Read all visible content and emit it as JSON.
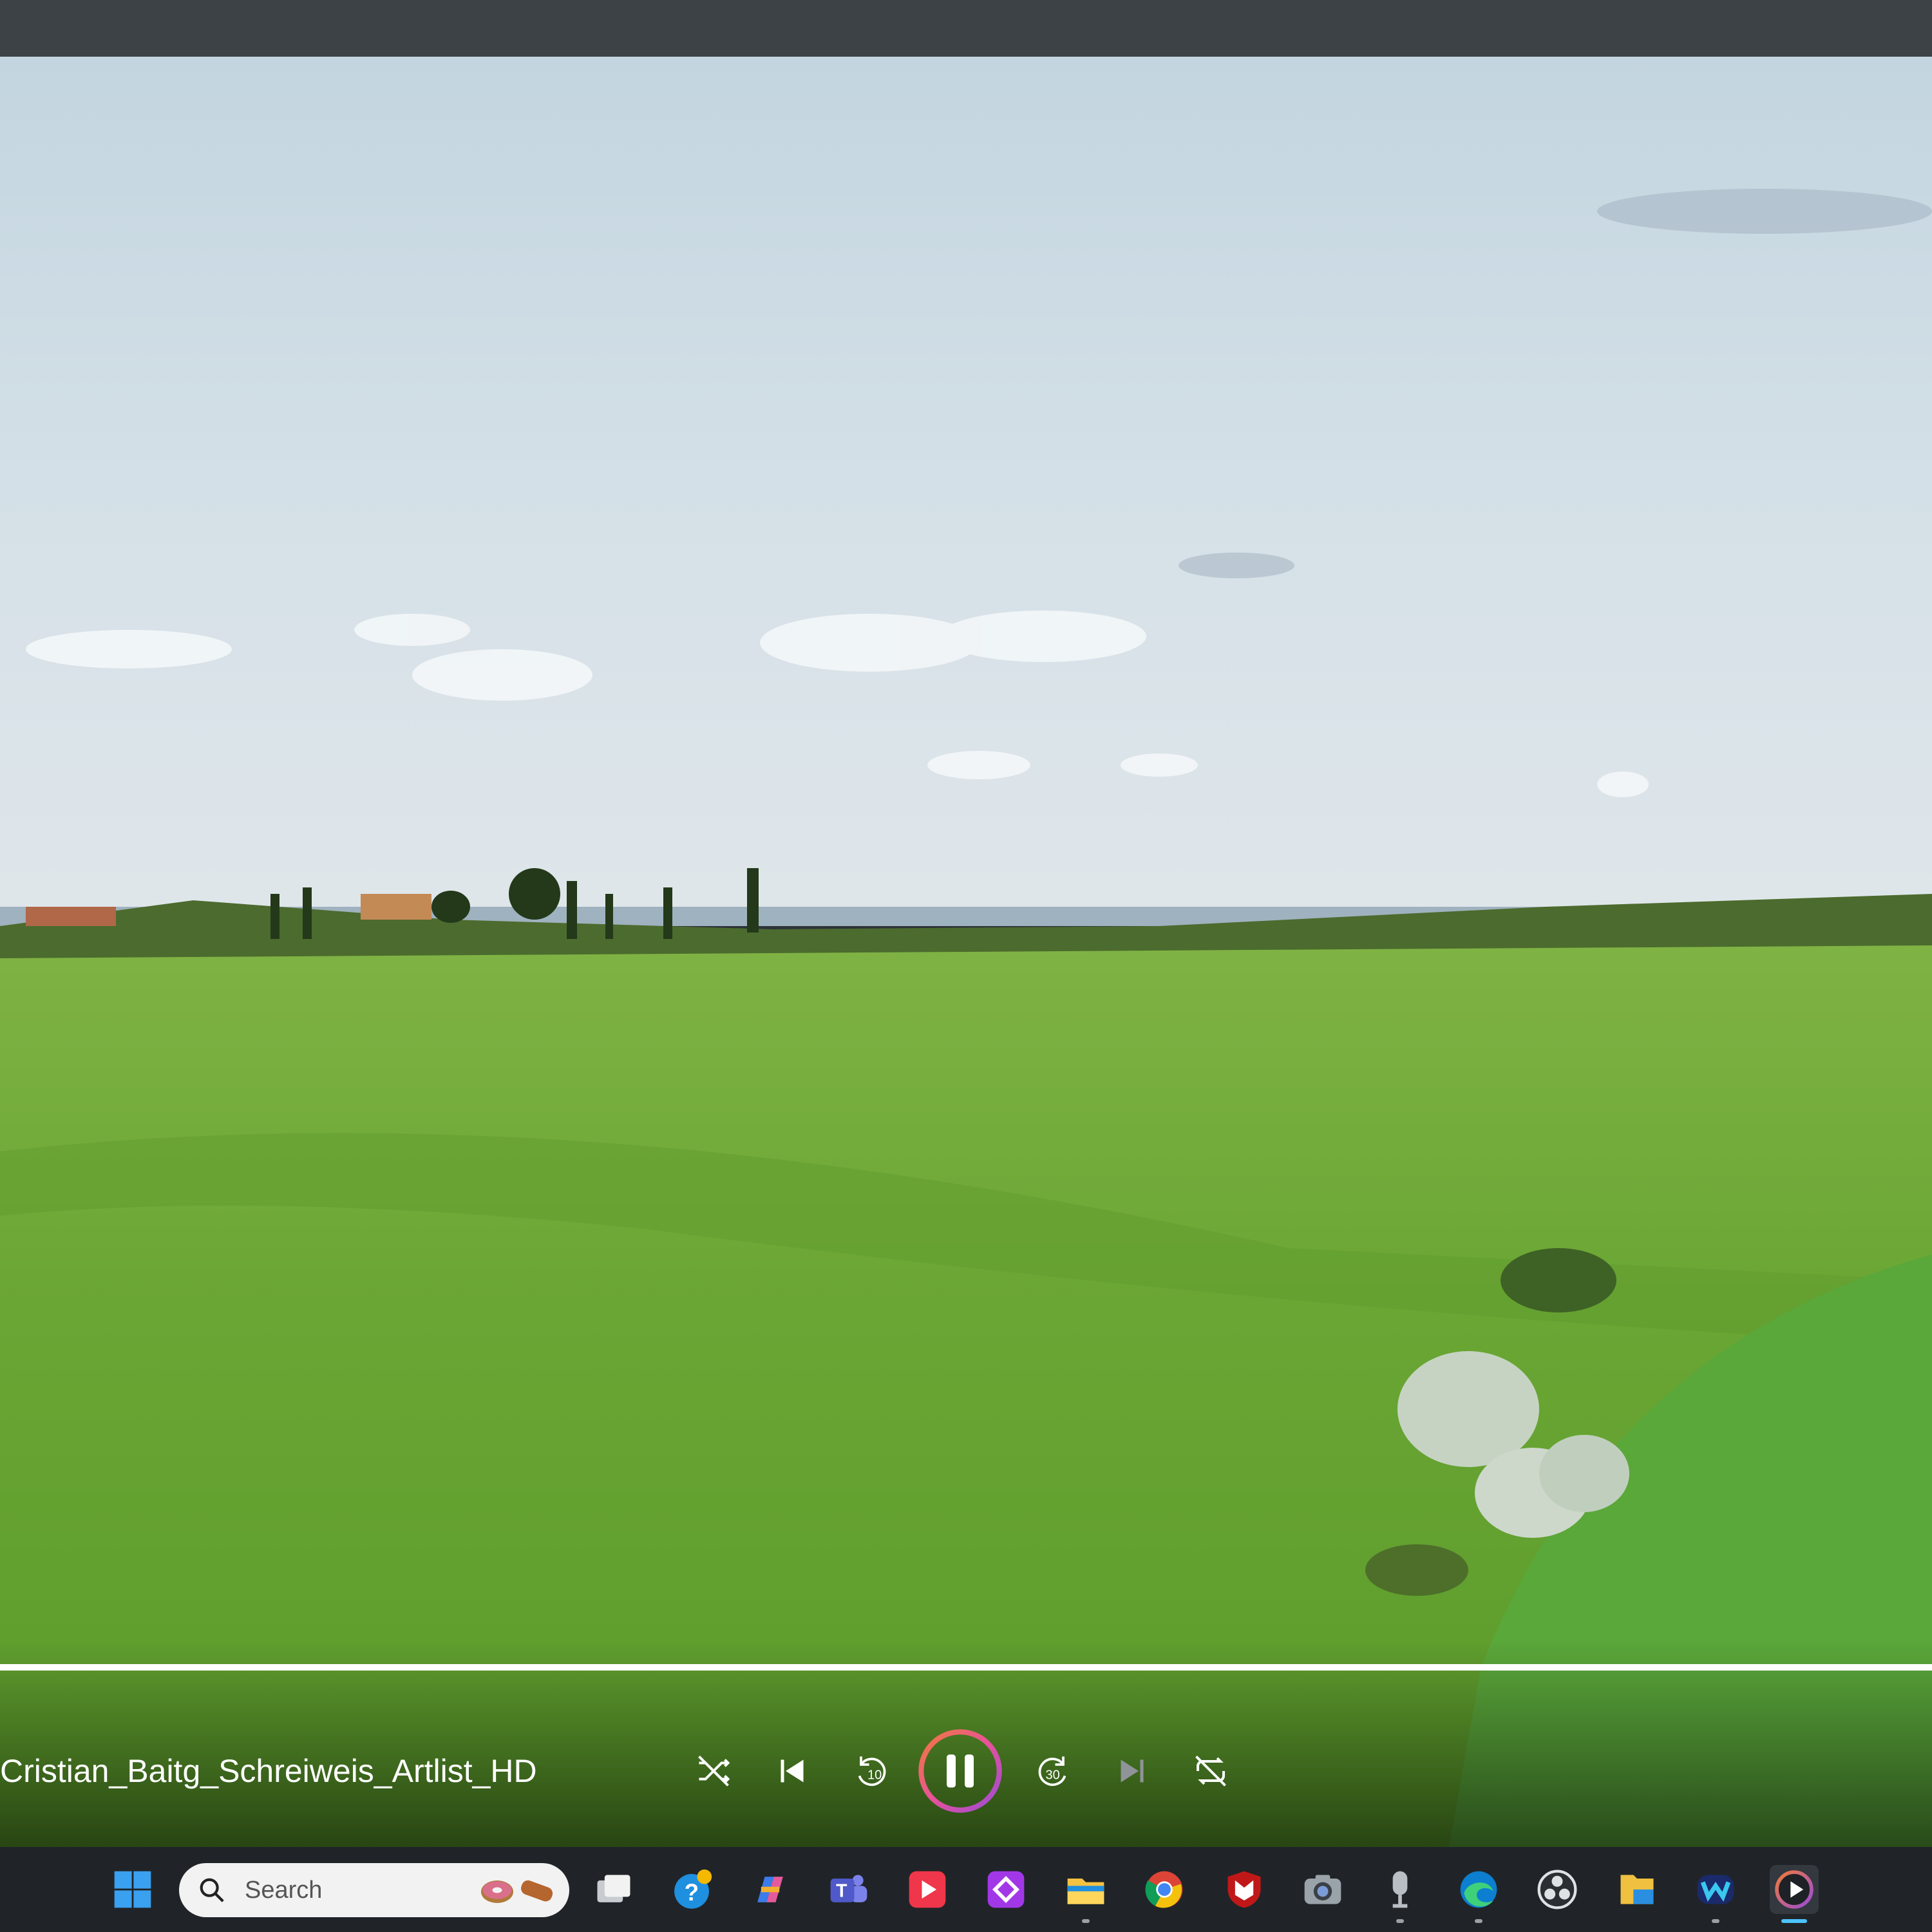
{
  "player": {
    "media_title": "Cristian_Baitg_Schreiweis_Artlist_HD",
    "progress": 1.0,
    "controls": [
      "shuffle",
      "previous",
      "rewind-10",
      "pause",
      "forward-30",
      "next",
      "repeat"
    ],
    "skip_back_seconds": "10",
    "skip_forward_seconds": "30",
    "accent_color": "#e8529a"
  },
  "taskbar": {
    "search_placeholder": "Search",
    "apps": [
      "start",
      "task-view",
      "get-help",
      "copilot",
      "teams",
      "video-app",
      "power-automate",
      "file-explorer",
      "chrome",
      "mcafee",
      "camera",
      "voice-recorder",
      "edge",
      "obs",
      "files",
      "clipchamp",
      "media-player"
    ]
  }
}
